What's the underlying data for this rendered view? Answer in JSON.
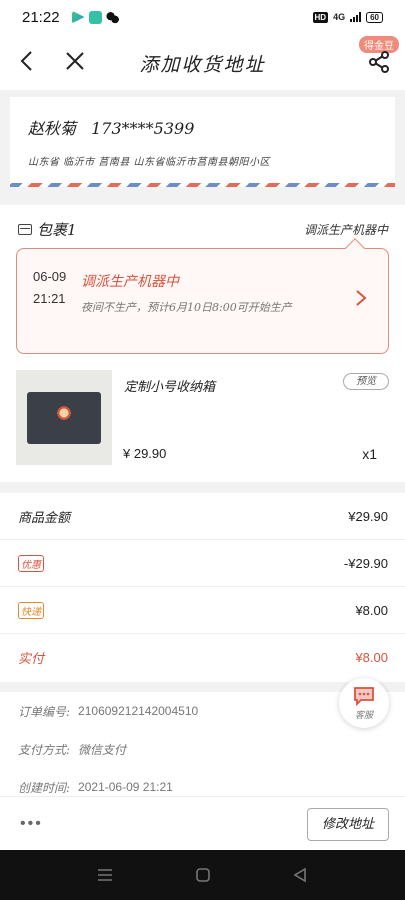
{
  "status_bar": {
    "time": "21:22",
    "hd": "HD",
    "network": "4G",
    "battery": "60"
  },
  "nav": {
    "title": "添加收货地址",
    "badge": "得金豆"
  },
  "address": {
    "name": "赵秋菊",
    "phone": "173****5399",
    "line": "山东省 临沂市 莒南县 山东省临沂市莒南县朝阳小区"
  },
  "package": {
    "title": "包裹1",
    "status": "调派生产机器中",
    "progress": {
      "date": "06-09",
      "time": "21:21",
      "status": "调派生产机器中",
      "desc": "夜间不生产，预计6月10日8:00可开始生产"
    },
    "product": {
      "name": "定制小号收纳箱",
      "preview_label": "预览",
      "price": "¥ 29.90",
      "qty": "x1"
    }
  },
  "summary": {
    "goods_label": "商品金额",
    "goods_value": "¥29.90",
    "discount_label": "优惠",
    "discount_value": "-¥29.90",
    "shipping_label": "快递",
    "shipping_value": "¥8.00",
    "paid_label": "实付",
    "paid_value": "¥8.00"
  },
  "order_info": {
    "order_no_label": "订单编号:",
    "order_no": "210609212142004510",
    "pay_label": "支付方式:",
    "pay_value": "微信支付",
    "created_label": "创建时间:",
    "created_value": "2021-06-09 21:21"
  },
  "service": {
    "label": "客服"
  },
  "bottom": {
    "more": "•••",
    "edit_address": "修改地址"
  },
  "colors": {
    "accent_red": "#d9533e",
    "border_pink": "#e58a78",
    "orange": "#e08a2b"
  }
}
